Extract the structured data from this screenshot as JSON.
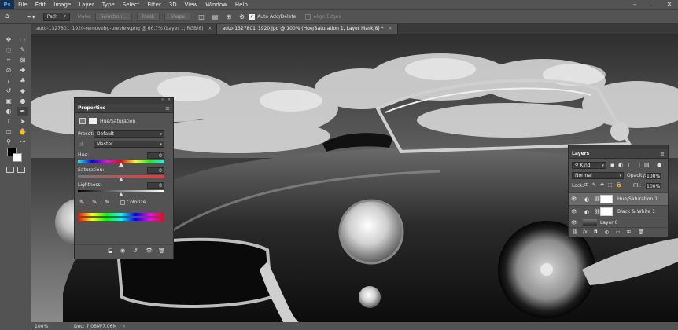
{
  "menubar": {
    "logo": "Ps",
    "items": [
      "File",
      "Edit",
      "Image",
      "Layer",
      "Type",
      "Select",
      "Filter",
      "3D",
      "View",
      "Window",
      "Help"
    ],
    "window_controls": [
      "–",
      "☐",
      "✕"
    ]
  },
  "options": {
    "mode": "Path",
    "make_label": "Make:",
    "selection_btn": "Selection...",
    "mask_btn": "Mask",
    "shape_btn": "Shape",
    "auto_add_delete": "Auto Add/Delete",
    "align_edges": "Align Edges"
  },
  "tabs": [
    {
      "label": "auto-1327801_1920-removebg-preview.png @ 66.7% (Layer 1, RGB/8)",
      "close": "×"
    },
    {
      "label": "auto-1327801_1920.jpg @ 100% (Hue/Saturation 1, Layer Mask/8) *",
      "close": "×"
    }
  ],
  "status": {
    "zoom": "100%",
    "doc": "Doc: 7.06M/7.06M"
  },
  "properties": {
    "title": "Properties",
    "adjustment": "Hue/Saturation",
    "preset_label": "Preset:",
    "preset_value": "Default",
    "channel": "Master",
    "hue_label": "Hue:",
    "hue_value": "0",
    "saturation_label": "Saturation:",
    "saturation_value": "0",
    "lightness_label": "Lightness:",
    "lightness_value": "0",
    "colorize_label": "Colorize"
  },
  "layers": {
    "title": "Layers",
    "kind": "Kind",
    "blend_mode": "Normal",
    "opacity_label": "Opacity:",
    "opacity_value": "100%",
    "lock_label": "Lock:",
    "fill_label": "Fill:",
    "fill_value": "100%",
    "items": [
      {
        "name": "Hue/Saturation 1"
      },
      {
        "name": "Black & White 1"
      },
      {
        "name": "Layer 0",
        "fx": "fx"
      }
    ]
  },
  "colors": {
    "accent": "#31a8ff",
    "panel": "#535353",
    "dark": "#282828"
  }
}
